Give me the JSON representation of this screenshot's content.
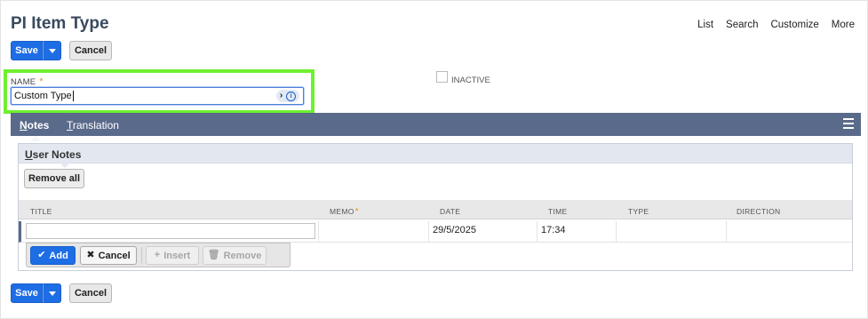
{
  "page": {
    "title": "PI Item Type",
    "topnav": [
      "List",
      "Search",
      "Customize",
      "More"
    ]
  },
  "toolbar": {
    "save_label": "Save",
    "cancel_label": "Cancel"
  },
  "form": {
    "name_label": "NAME",
    "required_mark": "*",
    "name_value": "Custom Type",
    "name_icon_chevron": "›",
    "name_icon_info": "i",
    "inactive_label": "INACTIVE",
    "inactive_checked": false
  },
  "tabs": [
    {
      "label_first": "N",
      "label_rest": "otes",
      "active": true
    },
    {
      "label_first": "T",
      "label_rest": "ranslation",
      "active": false
    }
  ],
  "subtab": {
    "label_first": "U",
    "label_rest": "ser Notes",
    "remove_all_label": "Remove all"
  },
  "table": {
    "columns": [
      "TITLE",
      "MEMO",
      "DATE",
      "TIME",
      "TYPE",
      "DIRECTION"
    ],
    "row": {
      "title": "",
      "memo": "",
      "date": "29/5/2025",
      "time": "17:34",
      "type": "",
      "direction": ""
    }
  },
  "row_buttons": {
    "add": "Add",
    "cancel": "Cancel",
    "insert": "Insert",
    "remove": "Remove"
  },
  "colors": {
    "primary": "#1d6de5",
    "tabbar": "#5a6a8a",
    "highlight": "#6ef030",
    "required": "#d59b23"
  }
}
